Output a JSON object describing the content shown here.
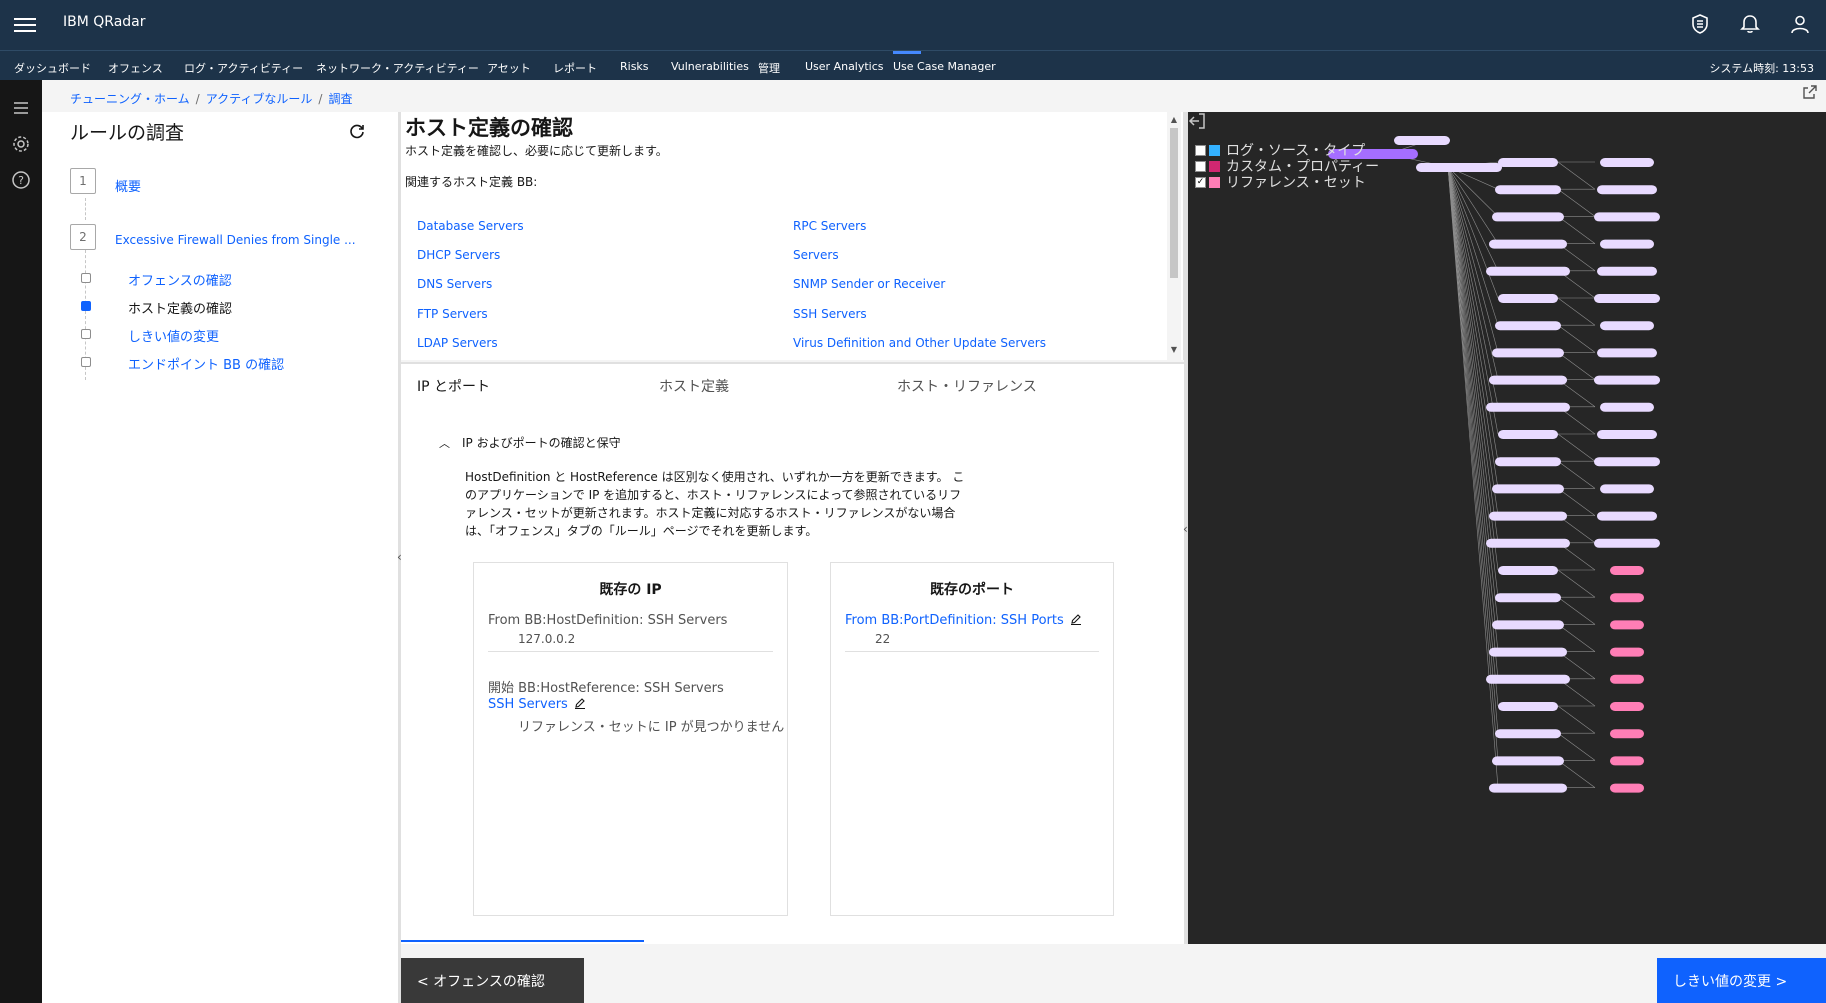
{
  "app": {
    "title": "IBM QRadar"
  },
  "nav": {
    "items": [
      "ダッシュボード",
      "オフェンス",
      "ログ・アクティビティー",
      "ネットワーク・アクティビティー",
      "アセット",
      "レポート",
      "Risks",
      "Vulnerabilities",
      "管理",
      "User Analytics",
      "Use Case Manager"
    ],
    "system_time": "システム時刻: 13:53"
  },
  "breadcrumb": {
    "items": [
      "チューニング・ホーム",
      "アクティブなルール",
      "調査"
    ],
    "separator": "/"
  },
  "left_panel": {
    "title": "ルールの調査",
    "steps": [
      {
        "num": "1",
        "label": "概要"
      },
      {
        "num": "2",
        "label": "Excessive Firewall Denies from Single ..."
      }
    ],
    "substeps": [
      {
        "label": "オフェンスの確認"
      },
      {
        "label": "ホスト定義の確認"
      },
      {
        "label": "しきい値の変更"
      },
      {
        "label": "エンドポイント BB の確認"
      }
    ]
  },
  "host_section": {
    "title": "ホスト定義の確認",
    "subtitle": "ホスト定義を確認し、必要に応じて更新します。",
    "related_label": "関連するホスト定義 BB:",
    "links_left": [
      "Database Servers",
      "DHCP Servers",
      "DNS Servers",
      "FTP Servers",
      "LDAP Servers"
    ],
    "links_right": [
      "RPC Servers",
      "Servers",
      "SNMP Sender or Receiver",
      "SSH Servers",
      "Virus Definition and Other Update Servers"
    ]
  },
  "tabs": [
    "IP とポート",
    "ホスト定義",
    "ホスト・リファレンス"
  ],
  "accordion": {
    "title": "IP およびポートの確認と保守",
    "body": "HostDefinition と HostReference は区別なく使用され、いずれか一方を更新できます。 このアプリケーションで IP を追加すると、ホスト・リファレンスによって参照されているリファレンス・セットが更新されます。ホスト定義に対応するホスト・リファレンスがない場合は、「オフェンス」タブの「ルール」ページでそれを更新します。"
  },
  "ip_card": {
    "title": "既存の IP",
    "from_label": "From BB:HostDefinition: SSH Servers",
    "from_value": "127.0.0.2",
    "start_label": "開始 BB:HostReference: SSH Servers",
    "ref_link": "SSH Servers",
    "ref_note": "リファレンス・セットに IP が見つかりません"
  },
  "port_card": {
    "title": "既存のポート",
    "from_label": "From BB:PortDefinition: SSH Ports",
    "from_value": "22"
  },
  "footer": {
    "prev_label": "< オフェンスの確認",
    "next_label": "しきい値の変更 >"
  },
  "graph": {
    "legend": [
      {
        "label": "ログ・ソース・タイプ",
        "checked": false,
        "color": "#33b1ff"
      },
      {
        "label": "カスタム・プロパティー",
        "checked": false,
        "color": "#d12771"
      },
      {
        "label": "リファレンス・セット",
        "checked": true,
        "color": "#ff7eb6"
      }
    ],
    "colors": {
      "node": "#e8daff",
      "root": "#a56eff",
      "ref": "#ff7eb6",
      "edge": "#8d8d8d"
    }
  },
  "colors": {
    "header": "#1d3349",
    "accent": "#0f62fe",
    "rail": "#161616"
  }
}
